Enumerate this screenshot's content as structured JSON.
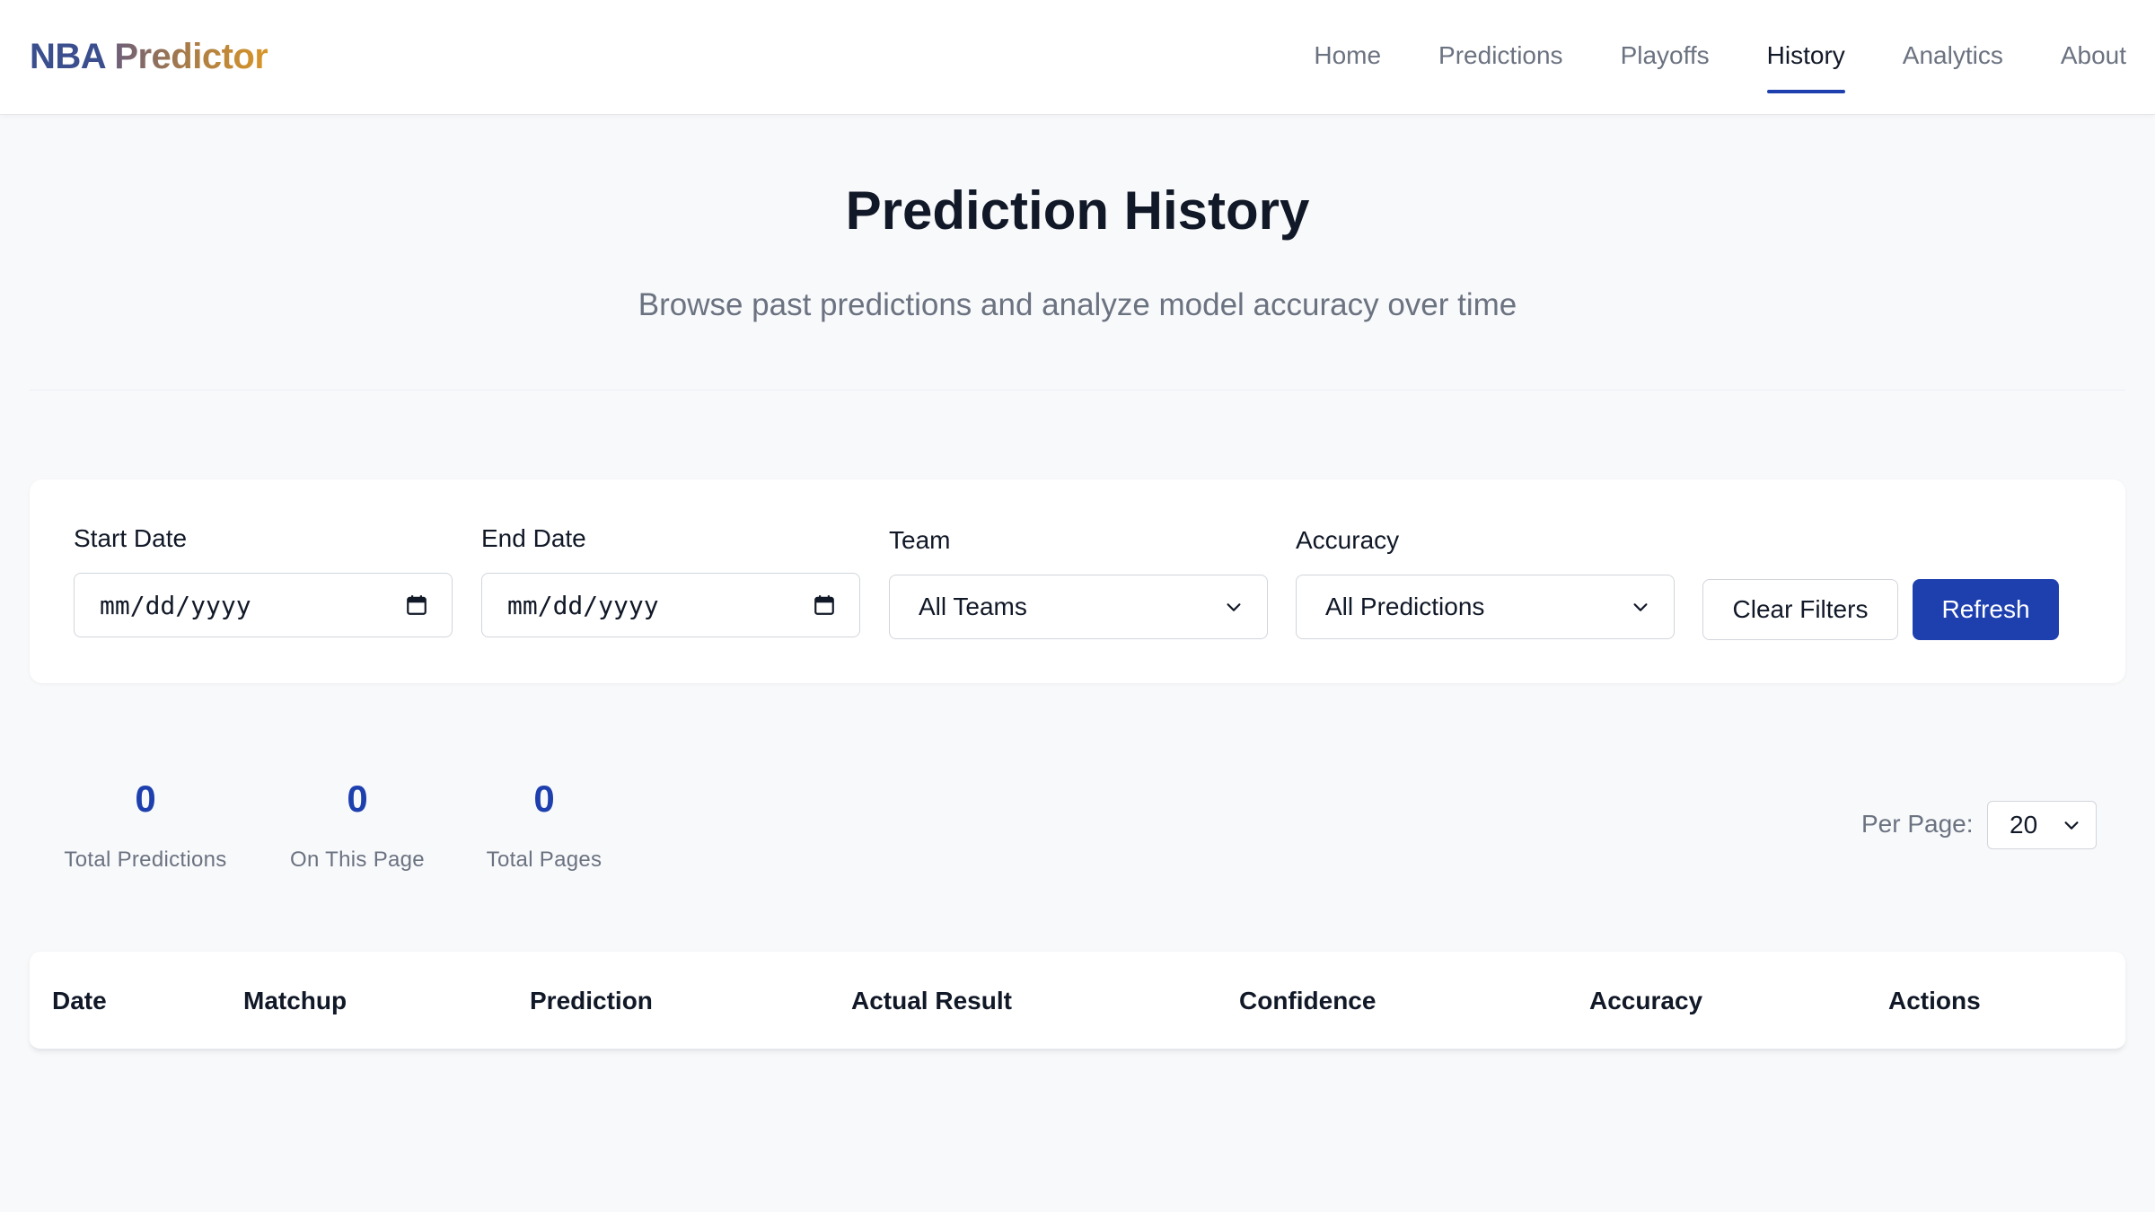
{
  "brand": {
    "part1": "NBA",
    "part2": "Predictor"
  },
  "nav": {
    "items": [
      {
        "label": "Home",
        "active": false
      },
      {
        "label": "Predictions",
        "active": false
      },
      {
        "label": "Playoffs",
        "active": false
      },
      {
        "label": "History",
        "active": true
      },
      {
        "label": "Analytics",
        "active": false
      },
      {
        "label": "About",
        "active": false
      }
    ]
  },
  "hero": {
    "title": "Prediction History",
    "subtitle": "Browse past predictions and analyze model accuracy over time"
  },
  "filters": {
    "start_date": {
      "label": "Start Date",
      "value": "mm/dd/yyyy",
      "icon": "calendar-icon"
    },
    "end_date": {
      "label": "End Date",
      "value": "mm/dd/yyyy",
      "icon": "calendar-icon"
    },
    "team": {
      "label": "Team",
      "value": "All Teams",
      "icon": "chevron-down-icon"
    },
    "accuracy": {
      "label": "Accuracy",
      "value": "All Predictions",
      "icon": "chevron-down-icon"
    },
    "clear_label": "Clear Filters",
    "refresh_label": "Refresh"
  },
  "stats": {
    "total_predictions": {
      "value": "0",
      "label": "Total Predictions"
    },
    "on_this_page": {
      "value": "0",
      "label": "On This Page"
    },
    "total_pages": {
      "value": "0",
      "label": "Total Pages"
    }
  },
  "pagination": {
    "per_page_label": "Per Page:",
    "per_page_value": "20"
  },
  "table": {
    "columns": [
      "Date",
      "Matchup",
      "Prediction",
      "Actual Result",
      "Confidence",
      "Accuracy",
      "Actions"
    ]
  },
  "colors": {
    "accent": "#1e40af",
    "muted_text": "#6b7280",
    "brand_gold": "#d99627"
  }
}
